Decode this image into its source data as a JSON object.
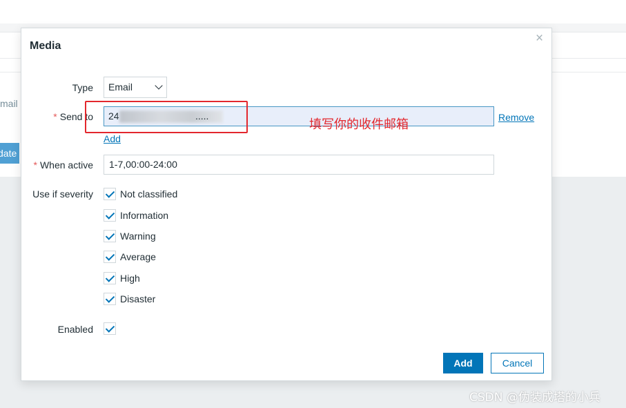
{
  "background": {
    "partial_label": "mail",
    "partial_button": "date"
  },
  "dialog": {
    "title": "Media",
    "close_glyph": "×",
    "type": {
      "label": "Type",
      "value": "Email"
    },
    "send_to": {
      "label": "Send to",
      "required_mark": "*",
      "value": "24",
      "value_tail": ".....",
      "remove_label": "Remove",
      "add_label": "Add"
    },
    "annotation": "填写你的收件邮箱",
    "when_active": {
      "label": "When active",
      "required_mark": "*",
      "value": "1-7,00:00-24:00"
    },
    "severity": {
      "label": "Use if severity",
      "options": [
        "Not classified",
        "Information",
        "Warning",
        "Average",
        "High",
        "Disaster"
      ]
    },
    "enabled": {
      "label": "Enabled"
    },
    "buttons": {
      "add": "Add",
      "cancel": "Cancel"
    }
  },
  "watermark": "CSDN @伪装成塔的小兵",
  "colors": {
    "accent": "#0275b8",
    "annotation_red": "#e3272d",
    "required_red": "#e45959"
  }
}
